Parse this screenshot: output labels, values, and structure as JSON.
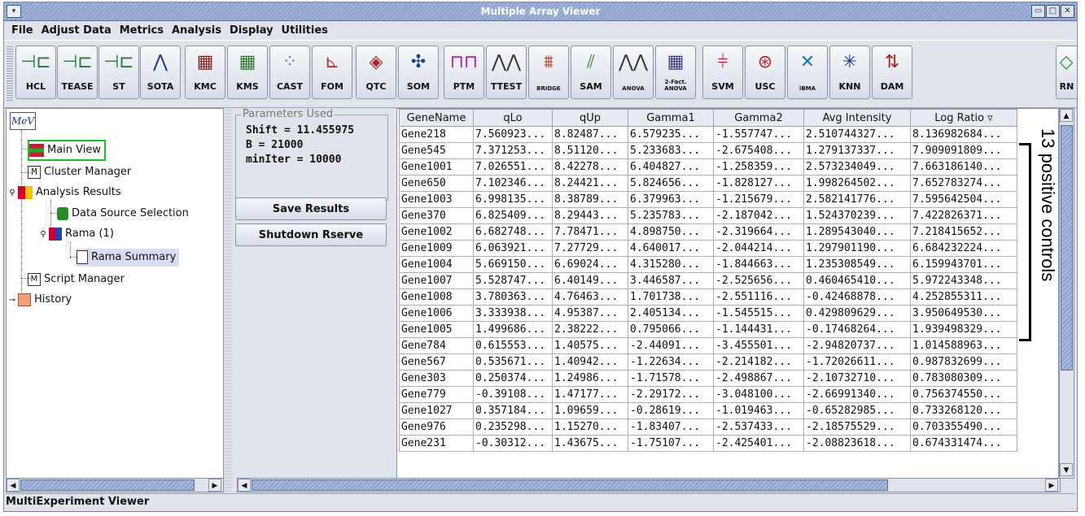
{
  "window": {
    "title": "Multiple Array Viewer",
    "controls": [
      "▭",
      "□",
      "✕"
    ]
  },
  "menu": [
    "File",
    "Adjust Data",
    "Metrics",
    "Analysis",
    "Display",
    "Utilities"
  ],
  "toolbar": [
    {
      "label": "HCL",
      "icon": "hcl-icon"
    },
    {
      "label": "TEASE",
      "icon": "tease-icon"
    },
    {
      "label": "ST",
      "icon": "st-icon"
    },
    {
      "label": "SOTA",
      "icon": "sota-icon"
    },
    {
      "label": "KMC",
      "icon": "kmc-icon"
    },
    {
      "label": "KMS",
      "icon": "kms-icon"
    },
    {
      "label": "CAST",
      "icon": "cast-icon"
    },
    {
      "label": "FOM",
      "icon": "fom-icon"
    },
    {
      "label": "QTC",
      "icon": "qtc-icon"
    },
    {
      "label": "SOM",
      "icon": "som-icon"
    },
    {
      "label": "PTM",
      "icon": "ptm-icon"
    },
    {
      "label": "TTEST",
      "icon": "ttest-icon"
    },
    {
      "label": "BRIDGE",
      "icon": "bridge-icon"
    },
    {
      "label": "SAM",
      "icon": "sam-icon"
    },
    {
      "label": "ANOVA",
      "icon": "anova-icon"
    },
    {
      "label": "2-Fact. ANOVA",
      "icon": "two-factor-anova-icon"
    },
    {
      "label": "SVM",
      "icon": "svm-icon"
    },
    {
      "label": "USC",
      "icon": "usc-icon"
    },
    {
      "label": "iBMA",
      "icon": "ibma-icon"
    },
    {
      "label": "KNN",
      "icon": "knn-icon"
    },
    {
      "label": "DAM",
      "icon": "dam-icon"
    },
    {
      "label": "RN",
      "icon": "rn-icon"
    }
  ],
  "tree": {
    "logo": "MeV",
    "items": [
      {
        "label": "Main View"
      },
      {
        "label": "Cluster Manager"
      },
      {
        "label": "Analysis Results"
      },
      {
        "label": "Data Source Selection"
      },
      {
        "label": "Rama (1)"
      },
      {
        "label": "Rama Summary"
      },
      {
        "label": "Script Manager"
      },
      {
        "label": "History"
      }
    ]
  },
  "params": {
    "legend": "Parameters Used",
    "lines": [
      "Shift = 11.455975",
      "B = 21000",
      "minIter = 10000"
    ],
    "save_label": "Save Results",
    "shutdown_label": "Shutdown Rserve"
  },
  "table": {
    "columns": [
      "GeneName",
      "qLo",
      "qUp",
      "Gamma1",
      "Gamma2",
      "Avg Intensity",
      "Log Ratio ▿"
    ],
    "rows": [
      [
        "Gene218",
        "7.560923...",
        "8.82487...",
        "6.579235...",
        "-1.557747...",
        "2.510744327...",
        "8.136982684..."
      ],
      [
        "Gene545",
        "7.371253...",
        "8.51120...",
        "5.233683...",
        "-2.675408...",
        "1.279137337...",
        "7.909091809..."
      ],
      [
        "Gene1001",
        "7.026551...",
        "8.42278...",
        "6.404827...",
        "-1.258359...",
        "2.573234049...",
        "7.663186140..."
      ],
      [
        "Gene650",
        "7.102346...",
        "8.24421...",
        "5.824656...",
        "-1.828127...",
        "1.998264502...",
        "7.652783274..."
      ],
      [
        "Gene1003",
        "6.998135...",
        "8.38789...",
        "6.379963...",
        "-1.215679...",
        "2.582141776...",
        "7.595642504..."
      ],
      [
        "Gene370",
        "6.825409...",
        "8.29443...",
        "5.235783...",
        "-2.187042...",
        "1.524370239...",
        "7.422826371..."
      ],
      [
        "Gene1002",
        "6.682748...",
        "7.78471...",
        "4.898750...",
        "-2.319664...",
        "1.289543040...",
        "7.218415652..."
      ],
      [
        "Gene1009",
        "6.063921...",
        "7.27729...",
        "4.640017...",
        "-2.044214...",
        "1.297901190...",
        "6.684232224..."
      ],
      [
        "Gene1004",
        "5.669150...",
        "6.69024...",
        "4.315280...",
        "-1.844663...",
        "1.235308549...",
        "6.159943701..."
      ],
      [
        "Gene1007",
        "5.528747...",
        "6.40149...",
        "3.446587...",
        "-2.525656...",
        "0.460465410...",
        "5.972243348..."
      ],
      [
        "Gene1008",
        "3.780363...",
        "4.76463...",
        "1.701738...",
        "-2.551116...",
        "-0.42468878...",
        "4.252855311..."
      ],
      [
        "Gene1006",
        "3.333938...",
        "4.95387...",
        "2.405134...",
        "-1.545515...",
        "0.429809629...",
        "3.950649530..."
      ],
      [
        "Gene1005",
        "1.499686...",
        "2.38222...",
        "0.795066...",
        "-1.144431...",
        "-0.17468264...",
        "1.939498329..."
      ],
      [
        "Gene784",
        "0.615553...",
        "1.40575...",
        "-2.44091...",
        "-3.455501...",
        "-2.94820737...",
        "1.014588963..."
      ],
      [
        "Gene567",
        "0.535671...",
        "1.40942...",
        "-1.22634...",
        "-2.214182...",
        "-1.72026611...",
        "0.987832699..."
      ],
      [
        "Gene303",
        "0.250374...",
        "1.24986...",
        "-1.71578...",
        "-2.498867...",
        "-2.10732710...",
        "0.783080309..."
      ],
      [
        "Gene779",
        "-0.39108...",
        "1.47177...",
        "-2.29172...",
        "-3.048100...",
        "-2.66991340...",
        "0.756374550..."
      ],
      [
        "Gene1027",
        "0.357184...",
        "1.09659...",
        "-0.28619...",
        "-1.019463...",
        "-0.65282985...",
        "0.733268120..."
      ],
      [
        "Gene976",
        "0.235298...",
        "1.15270...",
        "-1.83407...",
        "-2.537433...",
        "-2.18575529...",
        "0.703355490..."
      ],
      [
        "Gene231",
        "-0.30312...",
        "1.43675...",
        "-1.75107...",
        "-2.425401...",
        "-2.08823618...",
        "0.674331474..."
      ]
    ]
  },
  "annotation": "13 positive controls",
  "status": "MultiExperiment Viewer",
  "colors": {
    "titlebar": "#8ca4cb",
    "selection": "#d8dcf2",
    "accent_green": "#2bb52b"
  }
}
